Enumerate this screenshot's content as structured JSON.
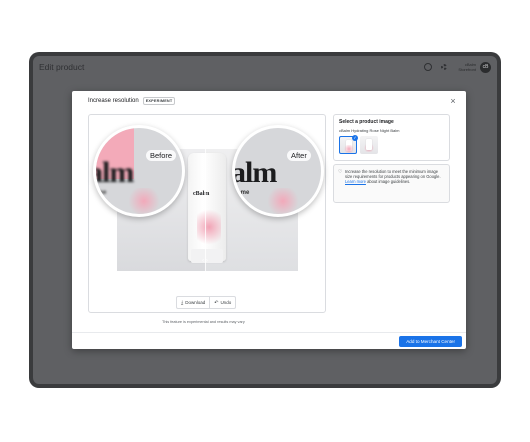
{
  "app": {
    "title": "Edit product",
    "account_line1": "cBalm",
    "account_line2": "Storefront",
    "avatar_initials": "cB"
  },
  "modal": {
    "title": "Increase resolution",
    "badge": "EXPERIMENT",
    "close_label": "×",
    "before_label": "Before",
    "after_label": "After",
    "lens_text": "alm",
    "lens_small_text": "ome",
    "product_text": "cBalm",
    "download_label": "Download",
    "undo_label": "Undo",
    "footnote": "This feature is experimental and results may vary",
    "primary_button": "Add to Merchant Center"
  },
  "panel": {
    "title": "Select a product image",
    "product_name": "cBalm Hydrating Rose Night Balm"
  },
  "tip": {
    "text": "Increase the resolution to meet the minimum image size requirements for products appearing on Google.",
    "link": "Learn more",
    "text_after": "about image guidelines."
  },
  "colors": {
    "accent": "#1a73e8",
    "pink": "#f3aab9",
    "overlay": "#5f6063"
  }
}
